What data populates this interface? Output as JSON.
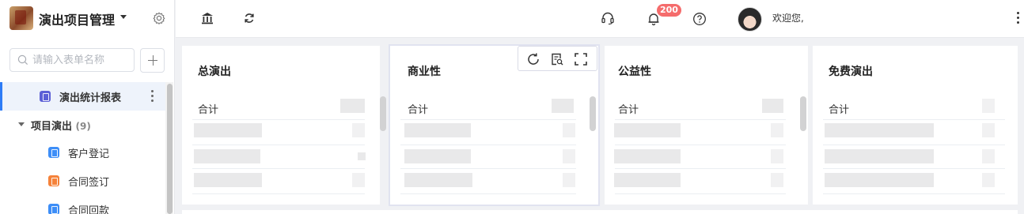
{
  "sidebar": {
    "app_title": "演出项目管理",
    "search_placeholder": "请输入表单名称",
    "items": [
      {
        "label": "演出统计报表",
        "icon": "report-form-icon",
        "icon_color": "#5b5fd6",
        "active": true
      },
      {
        "label": "项目演出",
        "count": "(9)",
        "type": "group"
      },
      {
        "label": "客户登记",
        "icon": "form-icon",
        "icon_color": "#3d8ef7"
      },
      {
        "label": "合同签订",
        "icon": "form-icon",
        "icon_color": "#f5823a"
      },
      {
        "label": "合同回款",
        "icon": "form-icon",
        "icon_color": "#3d8ef7"
      }
    ]
  },
  "header": {
    "icons": [
      "bank-icon",
      "refresh-icon",
      "headset-icon",
      "bell-icon",
      "help-icon"
    ],
    "notification_count": "200",
    "welcome": "欢迎您,"
  },
  "cards": [
    {
      "title": "总演出",
      "total_label": "合计"
    },
    {
      "title": "商业性",
      "total_label": "合计"
    },
    {
      "title": "公益性",
      "total_label": "合计"
    },
    {
      "title": "免费演出",
      "total_label": "合计"
    }
  ],
  "card_toolbar": {
    "icons": [
      "refresh-icon",
      "preview-icon",
      "fullscreen-icon"
    ]
  },
  "colors": {
    "accent": "#2e7cf6",
    "badge": "#f56c6c",
    "active_bg": "#eef3fb"
  }
}
